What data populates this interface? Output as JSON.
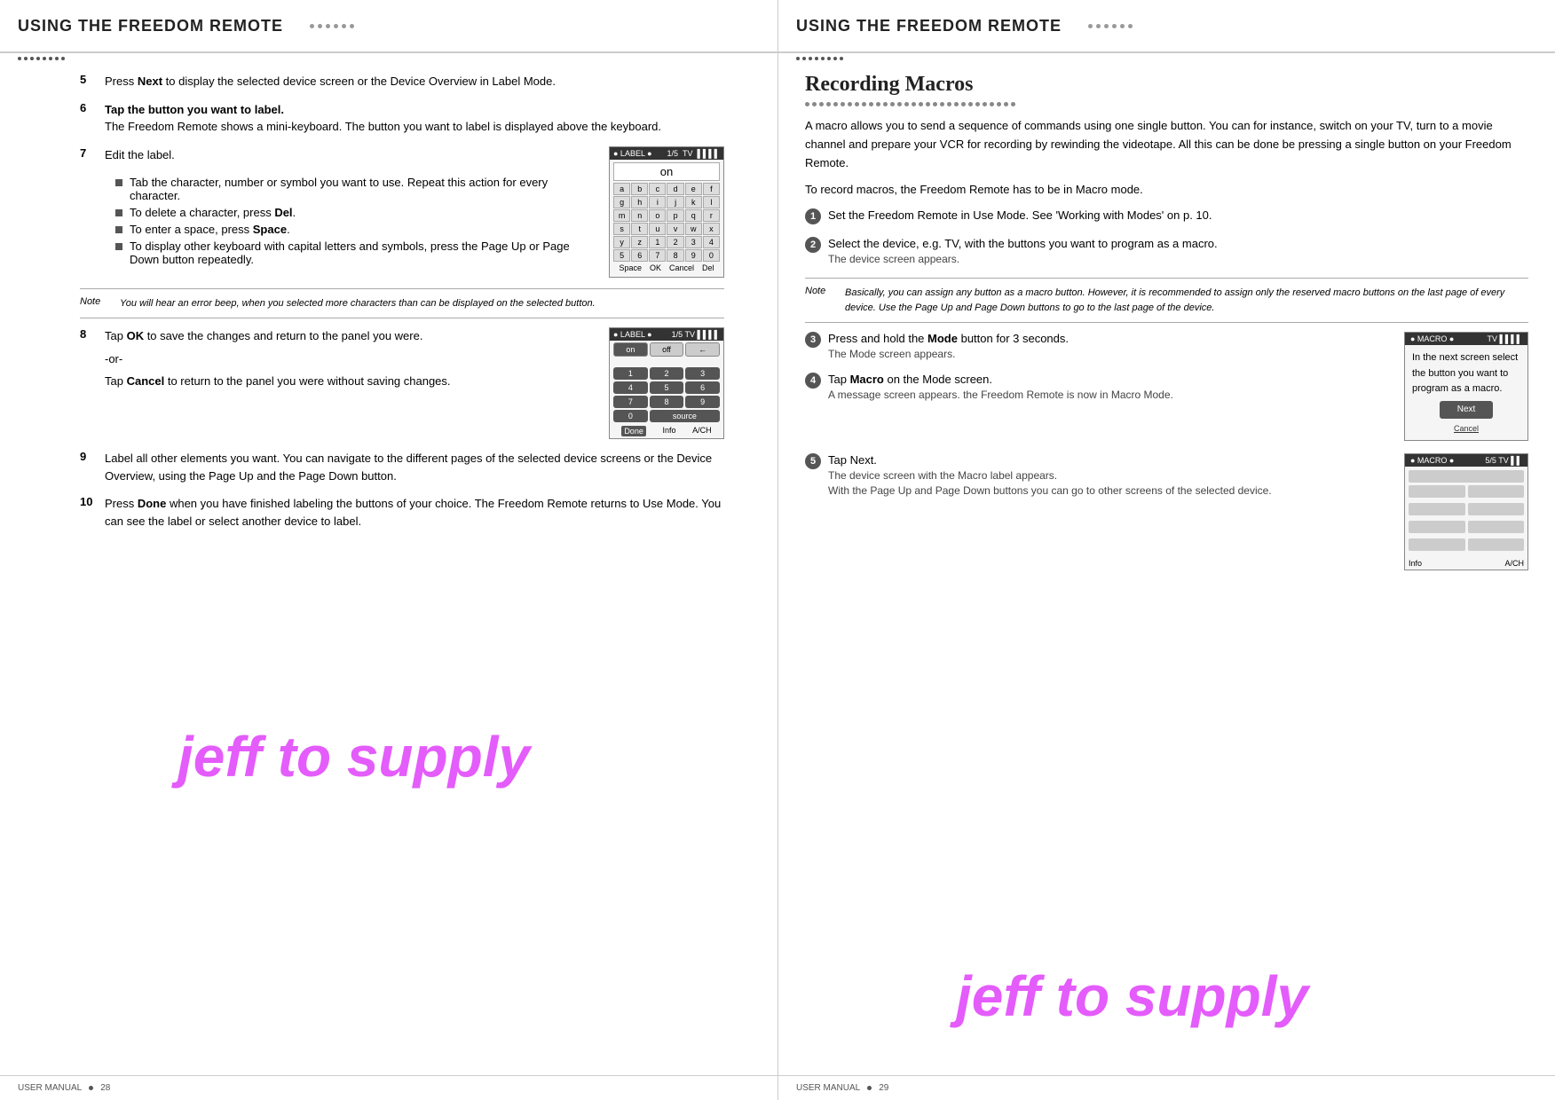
{
  "left": {
    "header_title": "USING THE FREEDOM REMOTE",
    "steps": [
      {
        "number": "5",
        "text": "Press ",
        "bold": "Next",
        "text2": " to display the selected device screen or the Device Overview in Label Mode."
      },
      {
        "number": "6",
        "text": "Tap the button you want to label.",
        "sub": "The Freedom Remote shows a mini-keyboard. The button you want to label is displayed above the keyboard."
      },
      {
        "number": "7",
        "text": "Edit the label."
      }
    ],
    "sub_bullets": [
      "Tab the character, number or symbol you want to use. Repeat this action for every character.",
      "To delete a character, press Del.",
      "To enter a space, press Space.",
      "To display other keyboard with capital letters and symbols, press the Page Up or Page Down button repeatedly."
    ],
    "sub_bold": [
      "Del",
      "Space"
    ],
    "note1_label": "Note",
    "note1_text": "You will hear an error beep, when you selected more characters than can be displayed on the selected button.",
    "step8_number": "8",
    "step8_text1": "Tap ",
    "step8_bold1": "OK",
    "step8_text2": " to save the changes and return to the panel you were.",
    "step8_or": "-or-",
    "step8_text3": "Tap ",
    "step8_bold2": "Cancel",
    "step8_text4": " to return to the panel you were without saving changes.",
    "step9_number": "9",
    "step9_text": "Label all other elements you want. You can navigate to the different pages of the selected device screens or the Device Overview, using the Page Up and the Page Down button.",
    "step10_number": "10",
    "step10_text1": "Press ",
    "step10_bold": "Done",
    "step10_text2": " when you have finished labeling the buttons of your choice. The Freedom Remote returns to Use Mode. You can see the label or select another device to label.",
    "label_screen": {
      "header_left": "● LABEL ●",
      "header_right": "1/5    TV",
      "input_value": "on",
      "keys": [
        "a",
        "b",
        "c",
        "d",
        "e",
        "f",
        "g",
        "h",
        "i",
        "j",
        "k",
        "l",
        "m",
        "n",
        "o",
        "p",
        "q",
        "r",
        "s",
        "t",
        "u",
        "v",
        "w",
        "x",
        "y",
        "z",
        "1",
        "2",
        "3",
        "4",
        "5",
        "6",
        "7",
        "8",
        "9",
        "0"
      ],
      "footer": "Space OK Cancel Del"
    },
    "panel_screen": {
      "header_left": "● LABEL ●",
      "header_right": "1/5    TV",
      "btn1": "on",
      "btn2": "off",
      "btn3": "←",
      "numpad": [
        "1",
        "2",
        "3",
        "4",
        "5",
        "6",
        "7",
        "8",
        "9",
        "0",
        "source"
      ],
      "footer": "Done Info A/CH"
    },
    "watermark": "jeff to supply",
    "footer_label": "USER MANUAL",
    "footer_bullet": "●",
    "footer_page": "28"
  },
  "right": {
    "header_title": "USING THE FREEDOM REMOTE",
    "section_title": "Recording Macros",
    "intro": "A macro allows you to send a sequence of commands using one single button. You can for instance, switch on your TV, turn to a movie channel and prepare your VCR for recording by rewinding the videotape. All this can be done be pressing a single button on your Freedom Remote.",
    "intro2": "To record macros, the Freedom Remote has to be in Macro mode.",
    "steps": [
      {
        "number": "1",
        "text": "Set the Freedom Remote in Use Mode. See 'Working with Modes' on p. 10."
      },
      {
        "number": "2",
        "text": "Select the device, e.g. TV, with the buttons you want to program as a macro.",
        "sub": "The device screen appears."
      }
    ],
    "note2_label": "Note",
    "note2_text": "Basically, you can assign any button as a macro button. However, it is recommended to assign only the reserved macro buttons on the last page of every device. Use the Page Up and Page Down buttons to go to the last page of the device.",
    "steps2": [
      {
        "number": "3",
        "text1": "Press and hold the ",
        "bold": "Mode",
        "text2": " button for 3 seconds.",
        "sub": "The Mode screen appears."
      },
      {
        "number": "4",
        "text1": "Tap ",
        "bold": "Macro",
        "text2": " on the Mode screen.",
        "sub1": "A message screen appears. the Freedom Remote is now in Macro Mode."
      }
    ],
    "step5_number": "5",
    "step5_text": "Tap Next.",
    "step5_sub1": "The device screen with the Macro label appears.",
    "step5_sub2": "With the Page Up and Page Down buttons you can go to other screens of the selected device.",
    "macro_screen1": {
      "header_left": "● MACRO ●",
      "header_right": "TV",
      "body": "In the next screen select the button you want to program as a macro.",
      "btn": "Next",
      "cancel": "Cancel"
    },
    "macro_screen2": {
      "header_left": "● MACRO ●",
      "header_right": "5/5    TV"
    },
    "watermark": "jeff to supply",
    "footer_label": "USER MANUAL",
    "footer_bullet": "●",
    "footer_page": "29"
  }
}
